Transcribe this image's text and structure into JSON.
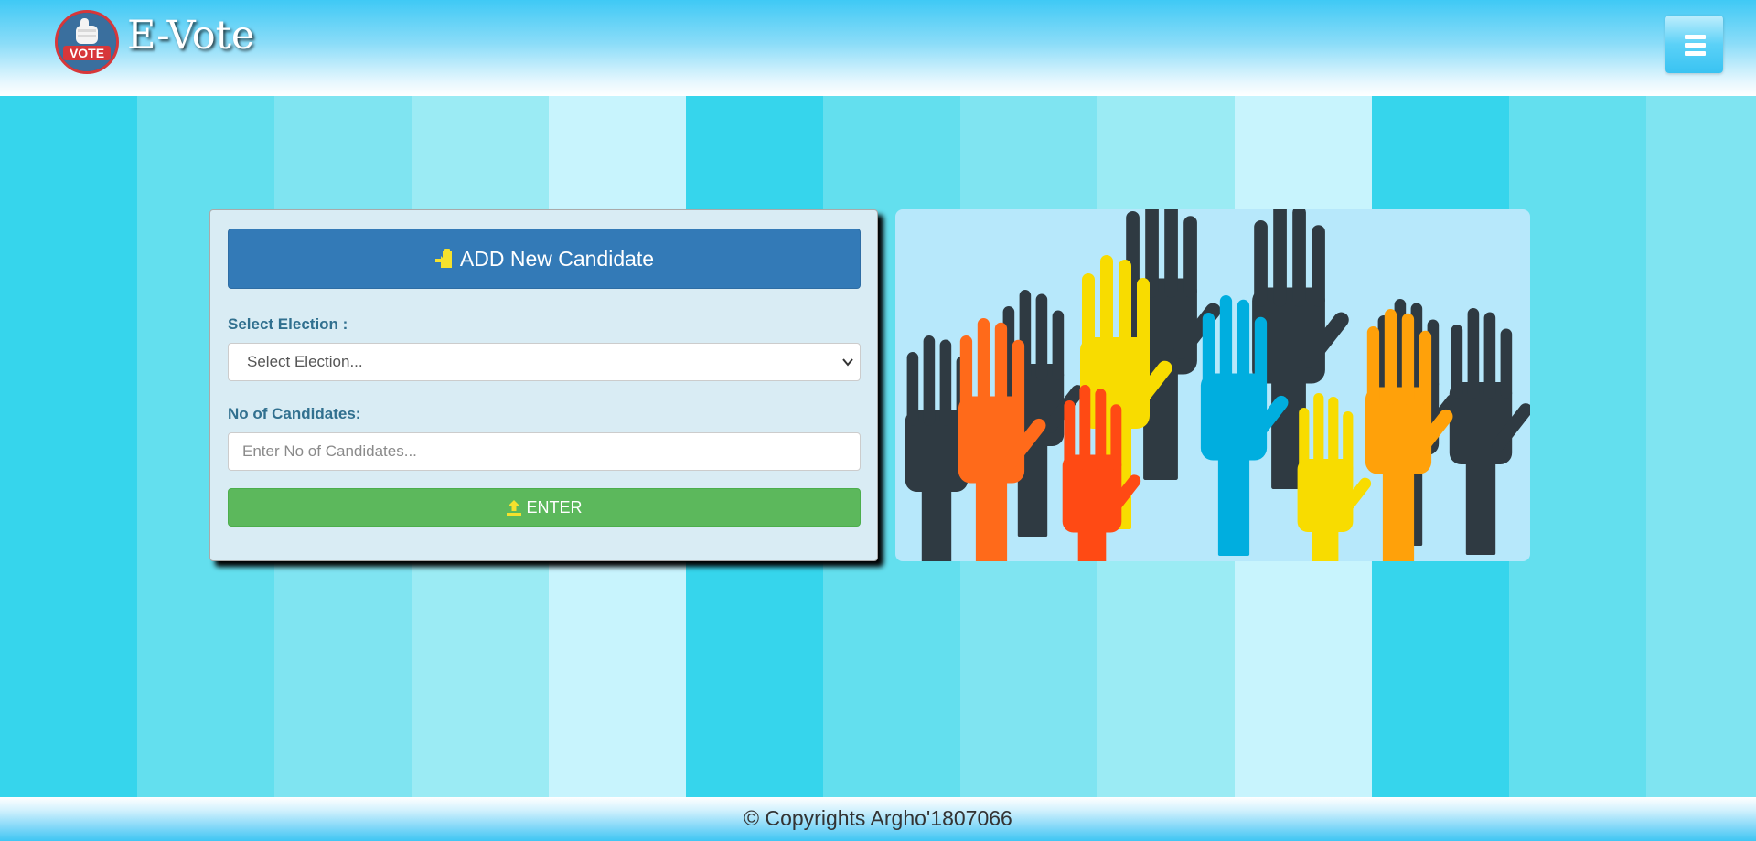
{
  "header": {
    "logo_text": "VOTE",
    "brand": "E-Vote",
    "menu_icon": "hamburger-icon"
  },
  "background": {
    "stripe_colors": [
      "#36d5ec",
      "#63dfee",
      "#7fe4f1",
      "#9bebf4",
      "#c8f4fd",
      "#36d5ec",
      "#63dfee",
      "#7fe4f1",
      "#9bebf4",
      "#c8f4fd",
      "#36d5ec",
      "#63dfee",
      "#7fe4f1"
    ]
  },
  "form": {
    "title": "ADD New Candidate",
    "title_icon": "add-user-icon",
    "election_label": "Select Election :",
    "election_selected": "Select Election...",
    "candidates_label": "No of Candidates:",
    "candidates_placeholder": "Enter No of Candidates...",
    "enter_label": "ENTER",
    "enter_icon": "upload-icon",
    "colors": {
      "primary": "#337ab7",
      "success": "#5cb85c",
      "label": "#31708f",
      "icon_accent": "#f5e12d"
    }
  },
  "illustration": {
    "subject": "raised-hands-image"
  },
  "footer": {
    "copyright": "© Copyrights Argho'1807066"
  }
}
